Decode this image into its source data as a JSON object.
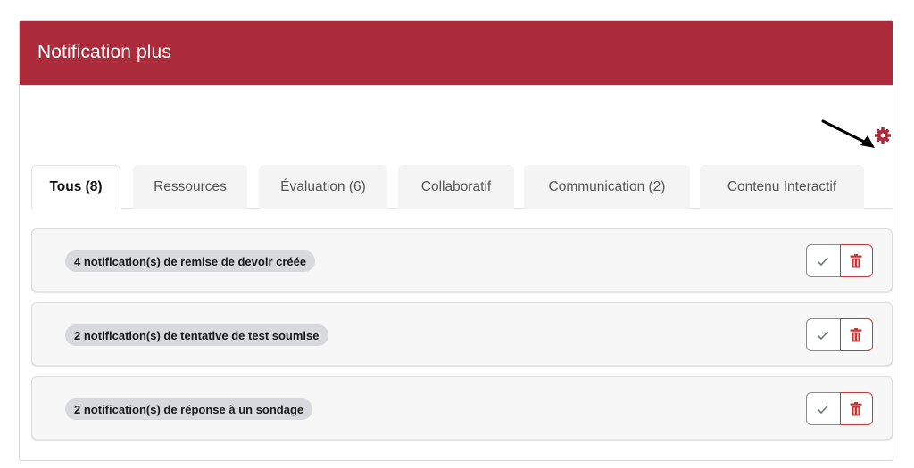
{
  "header": {
    "title": "Notification plus",
    "accent_color": "#ab2b3a"
  },
  "settings": {
    "icon": "gear-icon",
    "icon_color": "#ab2b3a",
    "pointer": "arrow-icon"
  },
  "tabs": [
    {
      "label": "Tous (8)",
      "active": true
    },
    {
      "label": "Ressources",
      "active": false
    },
    {
      "label": "Évaluation (6)",
      "active": false
    },
    {
      "label": "Collaboratif",
      "active": false
    },
    {
      "label": "Communication (2)",
      "active": false
    },
    {
      "label": "Contenu Interactif",
      "active": false
    }
  ],
  "notifications": [
    {
      "text": "4 notification(s) de remise de devoir créée"
    },
    {
      "text": "2 notification(s) de tentative de test soumise"
    },
    {
      "text": "2 notification(s) de réponse à un sondage"
    }
  ],
  "actions": {
    "mark_read_icon": "check-icon",
    "delete_icon": "trash-icon",
    "delete_color": "#c0393b"
  }
}
